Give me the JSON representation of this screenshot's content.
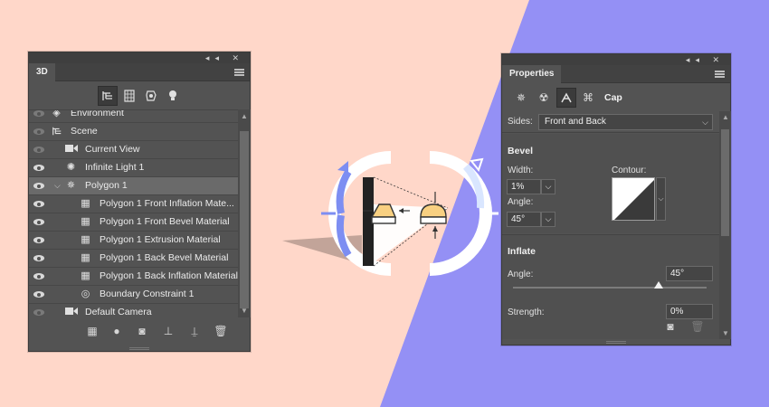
{
  "colors": {
    "background_left": "#ffd7c9",
    "background_right": "#9490f5",
    "panel": "#535353",
    "accent_blue": "#7d8ef2",
    "accent_yellow": "#f8d081"
  },
  "panel_3d": {
    "tab": "3D",
    "toolbar_icons": [
      "scene-icon",
      "mesh-icon",
      "materials-icon",
      "lights-icon"
    ],
    "rows": [
      {
        "label": "Environment",
        "icon": "environment-icon",
        "visible": false
      },
      {
        "label": "Scene",
        "icon": "scene-icon",
        "visible": false
      },
      {
        "label": "Current View",
        "icon": "camera-icon",
        "visible": false
      },
      {
        "label": "Infinite Light 1",
        "icon": "light-icon",
        "visible": true
      },
      {
        "label": "Polygon 1",
        "icon": "mesh-icon",
        "visible": true,
        "selected": true
      },
      {
        "label": "Polygon 1 Front Inflation Mate...",
        "icon": "material-icon",
        "visible": true
      },
      {
        "label": "Polygon 1 Front Bevel Material",
        "icon": "material-icon",
        "visible": true
      },
      {
        "label": "Polygon 1 Extrusion Material",
        "icon": "material-icon",
        "visible": true
      },
      {
        "label": "Polygon 1 Back Bevel Material",
        "icon": "material-icon",
        "visible": true
      },
      {
        "label": "Polygon 1 Back Inflation Material",
        "icon": "material-icon",
        "visible": true
      },
      {
        "label": "Boundary Constraint 1",
        "icon": "constraint-icon",
        "visible": true
      },
      {
        "label": "Default Camera",
        "icon": "camera-icon",
        "visible": false
      }
    ],
    "bottom_icons": [
      "new-mesh-icon",
      "add-light-icon",
      "render-icon",
      "ground-icon",
      "drop-to-plane-icon",
      "trash-icon"
    ]
  },
  "properties": {
    "tab": "Properties",
    "toolbar_icons": [
      "mesh-icon",
      "deform-icon",
      "cap-icon",
      "coordinates-icon"
    ],
    "active_tab_label": "Cap",
    "sides_label": "Sides:",
    "sides_value": "Front and Back",
    "bevel": {
      "title": "Bevel",
      "width_label": "Width:",
      "width_value": "1%",
      "angle_label": "Angle:",
      "angle_value": "45°",
      "contour_label": "Contour:"
    },
    "inflate": {
      "title": "Inflate",
      "angle_label": "Angle:",
      "angle_value": "45°",
      "angle_slider_fraction": 0.75,
      "strength_label": "Strength:",
      "strength_value": "0%"
    },
    "bottom_icons": [
      "render-icon",
      "trash-icon"
    ]
  }
}
